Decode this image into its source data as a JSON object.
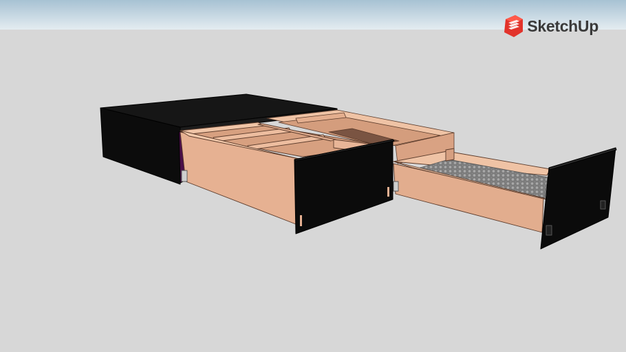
{
  "brand": {
    "name": "SketchUp",
    "icon": "sketchup-logo-icon",
    "icon_color": "#e2332b"
  },
  "colors": {
    "sky_top": "#a8c3d4",
    "sky_bottom": "#e2ebf0",
    "ground": "#d7d7d7",
    "cabinet_black": "#101010",
    "wood_inner": "#e9b79a",
    "wood_mid": "#d9a283",
    "wood_dark": "#b47c61",
    "cushion": "#8a8a8a"
  }
}
